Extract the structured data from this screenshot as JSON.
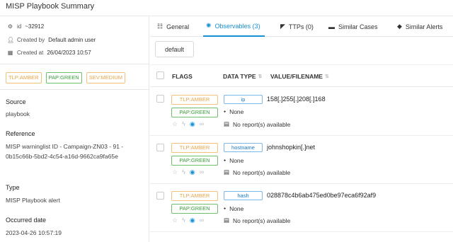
{
  "title": "MISP Playbook Summary",
  "meta": {
    "id_label": "id",
    "id_value": "~32912",
    "created_by_label": "Created by",
    "created_by_value": "Default admin user",
    "created_at_label": "Created at",
    "created_at_value": "26/04/2023 10:57"
  },
  "tags": [
    "TLP:AMBER",
    "PAP:GREEN",
    "SEV:MEDIUM"
  ],
  "fields": {
    "source_label": "Source",
    "source_value": "playbook",
    "reference_label": "Reference",
    "reference_value": "MISP warninglist ID - Campaign-ZN03 - 91 - 0b15c66b-5bd2-4c54-a16d-9662ca9fa65e",
    "type_label": "Type",
    "type_value": "MISP Playbook alert",
    "occurred_label": "Occurred date",
    "occurred_value": "2023-04-26 10:57:19"
  },
  "tabs": [
    {
      "label": "General",
      "icon": "sliders-icon"
    },
    {
      "label": "Observables (3)",
      "icon": "observable-icon"
    },
    {
      "label": "TTPs (0)",
      "icon": "ttp-icon"
    },
    {
      "label": "Similar Cases",
      "icon": "cases-icon"
    },
    {
      "label": "Similar Alerts",
      "icon": "alerts-icon"
    }
  ],
  "filter_button": "default",
  "table": {
    "headers": [
      "FLAGS",
      "DATA TYPE",
      "VALUE/FILENAME"
    ],
    "rows": [
      {
        "tlp": "TLP:AMBER",
        "pap": "PAP:GREEN",
        "type": "ip",
        "value": "158[.]255[.]208[.]168",
        "tags": "None",
        "reports": "No report(s) available"
      },
      {
        "tlp": "TLP:AMBER",
        "pap": "PAP:GREEN",
        "type": "hostname",
        "value": "johnshopkin[.]net",
        "tags": "None",
        "reports": "No report(s) available"
      },
      {
        "tlp": "TLP:AMBER",
        "pap": "PAP:GREEN",
        "type": "hash",
        "value": "028878c4b6ab475ed0be97eca6f92af9",
        "tags": "None",
        "reports": "No report(s) available"
      }
    ]
  },
  "colors": {
    "accent": "#1890d4",
    "amber": "#e8a54b",
    "green": "#3a9b3a"
  }
}
